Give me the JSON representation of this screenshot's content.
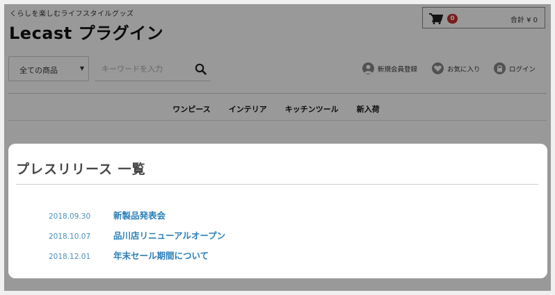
{
  "header": {
    "tagline": "くらしを楽しむライフスタイルグッズ",
    "brand": "Lecast プラグイン"
  },
  "cart": {
    "icon": "cart-icon",
    "count": "0",
    "total": "合計 ¥ 0"
  },
  "search": {
    "category": "全ての商品",
    "placeholder": "キーワードを入力",
    "icon": "search-icon"
  },
  "user_links": [
    {
      "label": "新規会員登録",
      "icon": "user-icon"
    },
    {
      "label": "お気に入り",
      "icon": "heart-icon"
    },
    {
      "label": "ログイン",
      "icon": "lock-icon"
    }
  ],
  "nav": [
    {
      "label": "ワンピース"
    },
    {
      "label": "インテリア"
    },
    {
      "label": "キッチンツール"
    },
    {
      "label": "新入荷"
    }
  ],
  "modal": {
    "title": "プレスリリース 一覧",
    "items": [
      {
        "date": "2018.09.30",
        "title": "新製品発表会"
      },
      {
        "date": "2018.10.07",
        "title": "品川店リニューアルオープン"
      },
      {
        "date": "2018.12.01",
        "title": "年末セール期間について"
      }
    ]
  },
  "colors": {
    "accent": "#2a7fb8",
    "badge": "#c9302c",
    "overlay": "rgba(0,0,0,0.4)"
  }
}
